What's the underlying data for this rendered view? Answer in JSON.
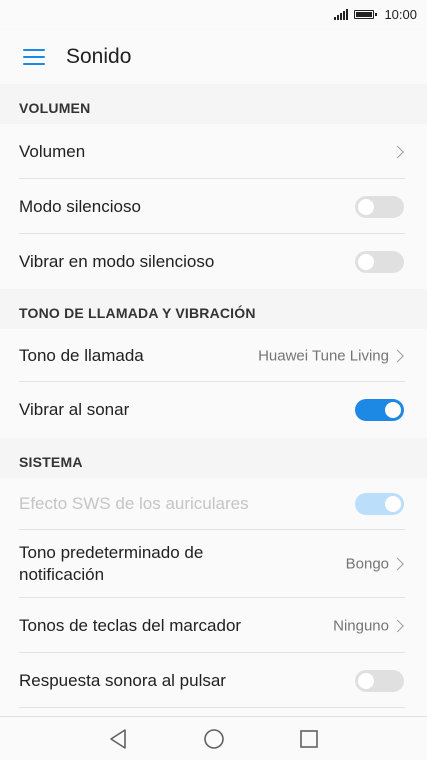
{
  "status_bar": {
    "time": "10:00"
  },
  "app_bar": {
    "title": "Sonido"
  },
  "sections": {
    "volumen": {
      "header": "VOLUMEN"
    },
    "tono": {
      "header": "TONO DE LLAMADA Y VIBRACIÓN"
    },
    "sistema": {
      "header": "SISTEMA"
    }
  },
  "rows": {
    "volumen": {
      "label": "Volumen"
    },
    "modo_silencioso": {
      "label": "Modo silencioso",
      "state": "off"
    },
    "vibrar_silencioso": {
      "label": "Vibrar en modo silencioso",
      "state": "off"
    },
    "tono_llamada": {
      "label": "Tono de llamada",
      "value": "Huawei Tune Living"
    },
    "vibrar_sonar": {
      "label": "Vibrar al sonar",
      "state": "on"
    },
    "efecto_sws": {
      "label": "Efecto SWS de los auriculares",
      "state": "on-disabled"
    },
    "tono_notificacion": {
      "label_line1": "Tono predeterminado de",
      "label_line2": "notificación",
      "value": "Bongo"
    },
    "tonos_teclas": {
      "label": "Tonos de teclas del marcador",
      "value": "Ninguno"
    },
    "respuesta_sonora": {
      "label": "Respuesta sonora al pulsar",
      "state": "off"
    }
  },
  "colors": {
    "accent": "#1e88e5",
    "background": "#f5f5f5",
    "row": "#fafafa"
  },
  "icons": {
    "menu": "menu-icon",
    "back": "back-icon",
    "home": "home-icon",
    "recents": "recents-icon",
    "signal": "signal-icon",
    "battery": "battery-icon",
    "chevron": "chevron-right-icon"
  }
}
